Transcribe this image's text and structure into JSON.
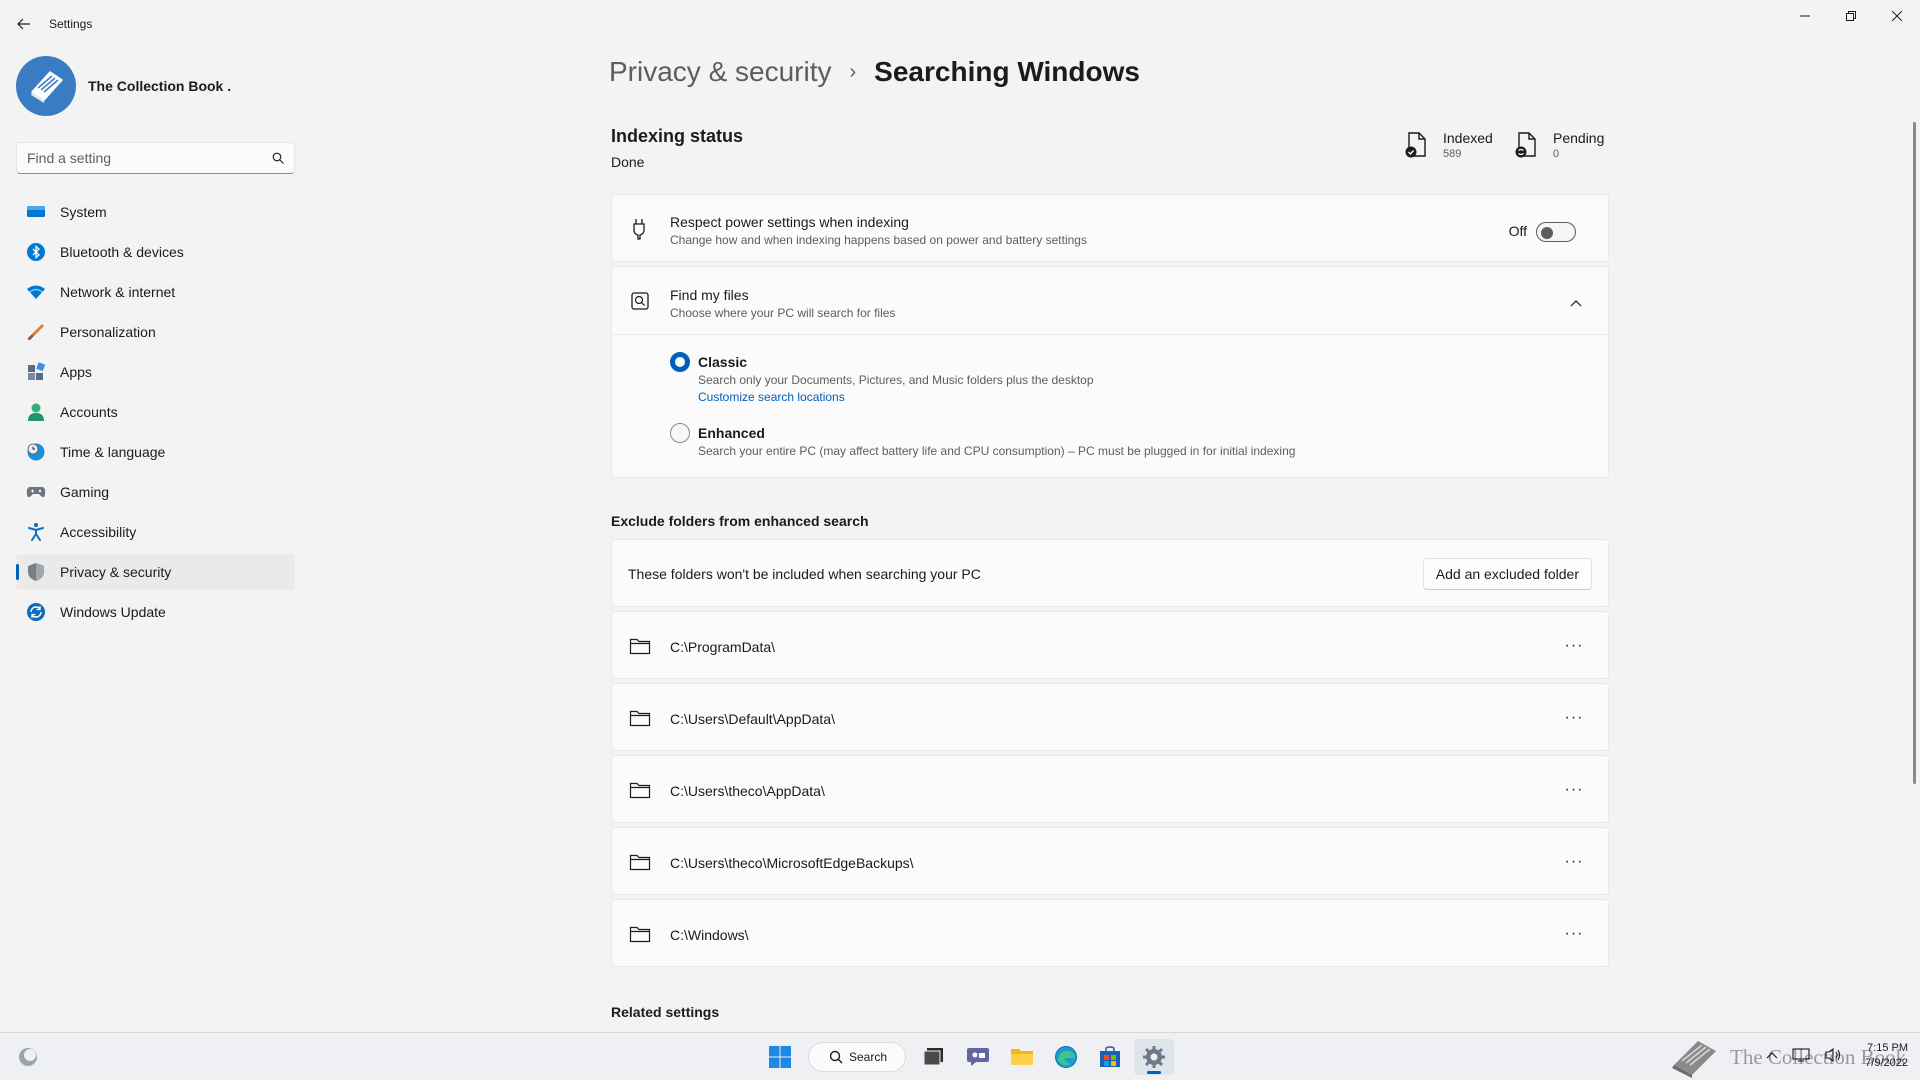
{
  "window": {
    "title": "Settings"
  },
  "profile": {
    "name": "The Collection Book ."
  },
  "search": {
    "placeholder": "Find a setting"
  },
  "sidebar": {
    "items": [
      {
        "label": "System",
        "icon": "system-icon",
        "color": "#0078d4"
      },
      {
        "label": "Bluetooth & devices",
        "icon": "bluetooth-icon",
        "color": "#0078d4"
      },
      {
        "label": "Network & internet",
        "icon": "wifi-icon",
        "color": "#0078d4"
      },
      {
        "label": "Personalization",
        "icon": "brush-icon",
        "color": "#e07a3c"
      },
      {
        "label": "Apps",
        "icon": "apps-icon",
        "color": "#5b6b86"
      },
      {
        "label": "Accounts",
        "icon": "person-icon",
        "color": "#2bb37b"
      },
      {
        "label": "Time & language",
        "icon": "clock-globe-icon",
        "color": "#1b8fd1"
      },
      {
        "label": "Gaming",
        "icon": "gamepad-icon",
        "color": "#6d7580"
      },
      {
        "label": "Accessibility",
        "icon": "accessibility-icon",
        "color": "#0f6cbd"
      },
      {
        "label": "Privacy & security",
        "icon": "shield-icon",
        "color": "#7a7f87"
      },
      {
        "label": "Windows Update",
        "icon": "update-icon",
        "color": "#0f6cbd"
      }
    ],
    "active_index": 9
  },
  "breadcrumb": {
    "parent": "Privacy & security",
    "separator": "›",
    "current": "Searching Windows"
  },
  "indexing": {
    "title": "Indexing status",
    "status": "Done",
    "indexed_label": "Indexed",
    "indexed_value": "589",
    "pending_label": "Pending",
    "pending_value": "0"
  },
  "power": {
    "title": "Respect power settings when indexing",
    "description": "Change how and when indexing happens based on power and battery settings",
    "toggle_label": "Off",
    "toggle_on": false
  },
  "find_files": {
    "title": "Find my files",
    "description": "Choose where your PC will search for files",
    "options": [
      {
        "label": "Classic",
        "description": "Search only your Documents, Pictures, and Music folders plus the desktop",
        "link": "Customize search locations",
        "selected": true
      },
      {
        "label": "Enhanced",
        "description": "Search your entire PC (may affect battery life and CPU consumption) – PC must be plugged in for initial indexing",
        "selected": false
      }
    ]
  },
  "exclude": {
    "section_title": "Exclude folders from enhanced search",
    "info": "These folders won't be included when searching your PC",
    "add_button": "Add an excluded folder",
    "more_label": "···",
    "folders": [
      "C:\\ProgramData\\",
      "C:\\Users\\Default\\AppData\\",
      "C:\\Users\\theco\\AppData\\",
      "C:\\Users\\theco\\MicrosoftEdgeBackups\\",
      "C:\\Windows\\"
    ]
  },
  "related": {
    "title": "Related settings"
  },
  "taskbar": {
    "search_label": "Search",
    "watermark": "The Collection Book",
    "time": "7:15 PM",
    "date": "7/9/2022",
    "accent": "#005fb8"
  }
}
